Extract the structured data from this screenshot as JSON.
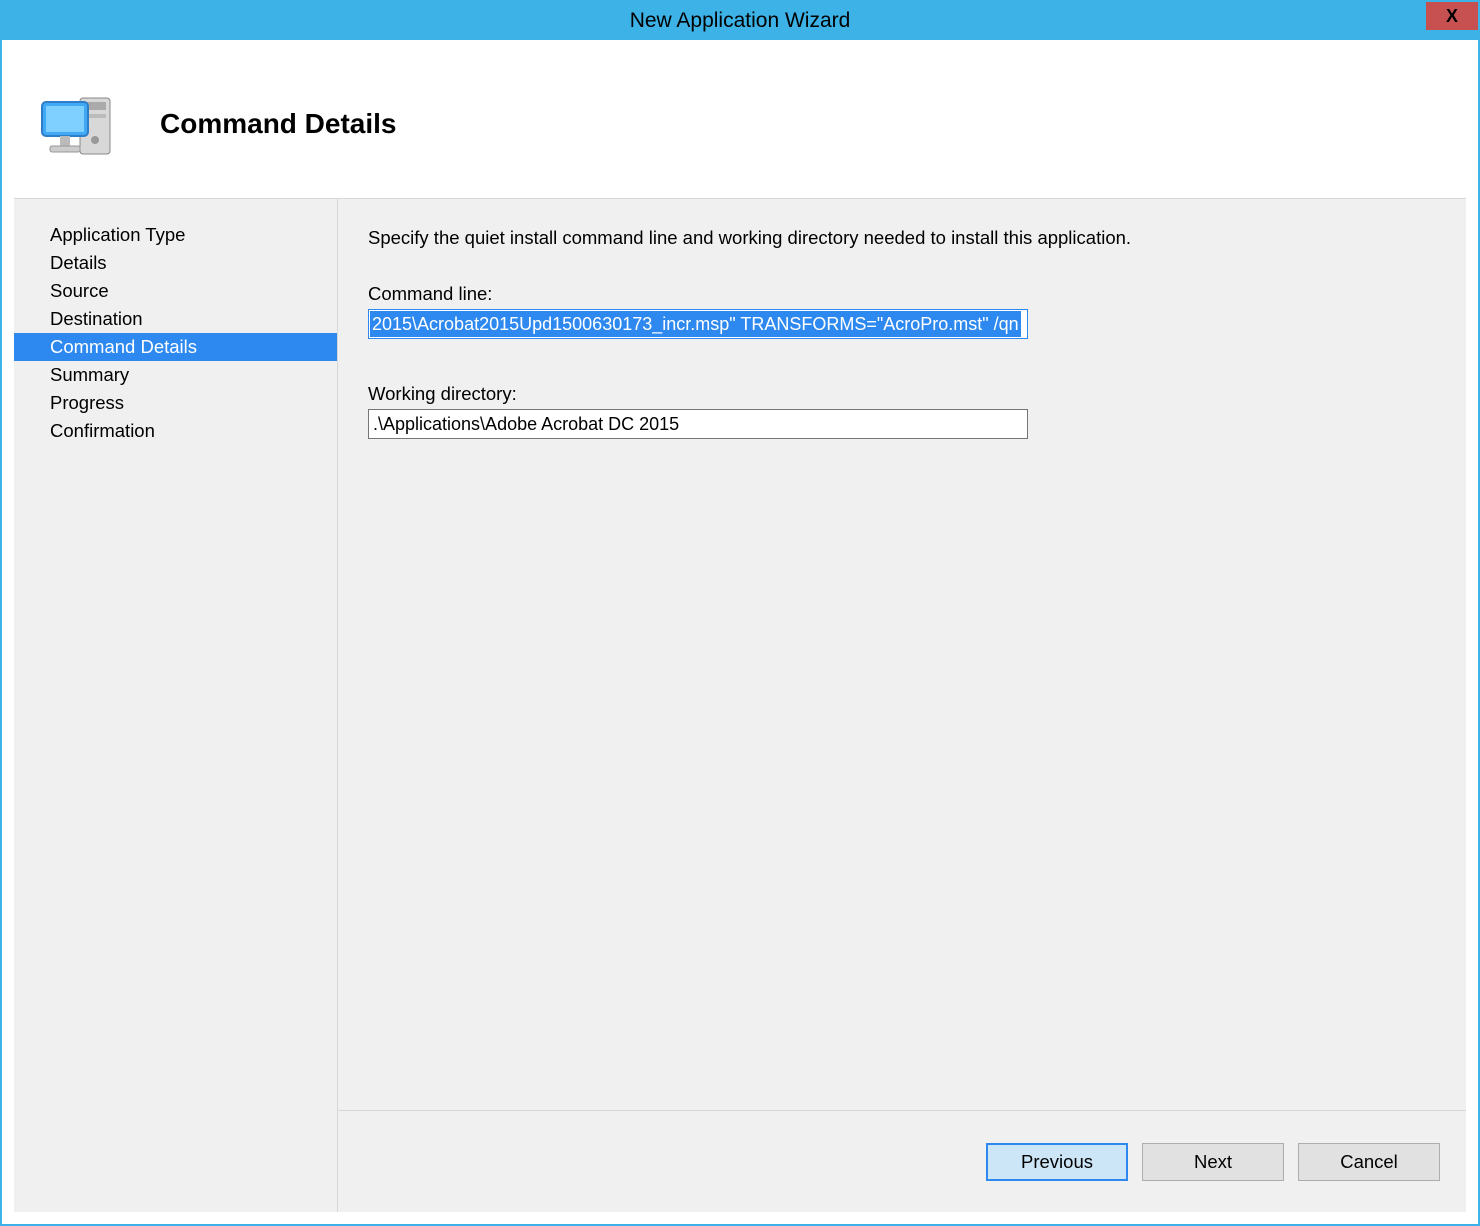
{
  "window": {
    "title": "New Application Wizard",
    "close_label": "X"
  },
  "header": {
    "title": "Command Details"
  },
  "nav": {
    "items": [
      {
        "label": "Application Type",
        "selected": false
      },
      {
        "label": "Details",
        "selected": false
      },
      {
        "label": "Source",
        "selected": false
      },
      {
        "label": "Destination",
        "selected": false
      },
      {
        "label": "Command Details",
        "selected": true
      },
      {
        "label": "Summary",
        "selected": false
      },
      {
        "label": "Progress",
        "selected": false
      },
      {
        "label": "Confirmation",
        "selected": false
      }
    ]
  },
  "main": {
    "instruction": "Specify the quiet install command line and working directory needed to install this application.",
    "cmdline_label": "Command line:",
    "cmdline_value": "2015\\Acrobat2015Upd1500630173_incr.msp\" TRANSFORMS=\"AcroPro.mst\"  /qn",
    "workdir_label": "Working directory:",
    "workdir_value": ".\\Applications\\Adobe Acrobat DC 2015"
  },
  "footer": {
    "previous": "Previous",
    "next": "Next",
    "cancel": "Cancel"
  }
}
